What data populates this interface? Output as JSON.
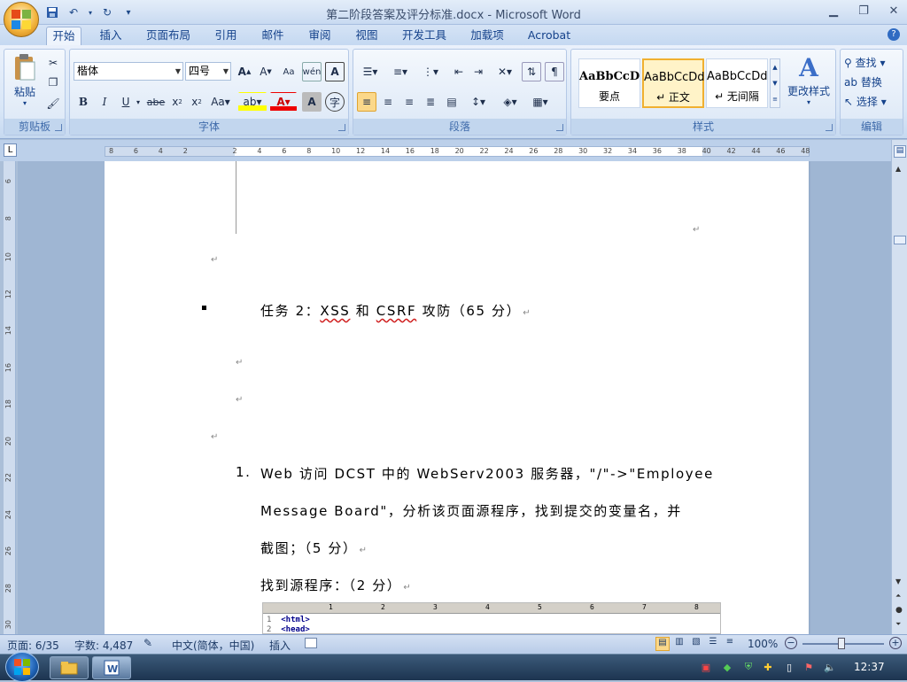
{
  "window": {
    "title": "第二阶段答案及评分标准.docx - Microsoft Word"
  },
  "quick_access": [
    "save-icon",
    "undo-icon",
    "redo-icon",
    "customize-icon"
  ],
  "tabs": [
    "开始",
    "插入",
    "页面布局",
    "引用",
    "邮件",
    "审阅",
    "视图",
    "开发工具",
    "加载项",
    "Acrobat"
  ],
  "ribbon": {
    "clipboard": {
      "label": "剪贴板",
      "paste": "粘贴"
    },
    "font": {
      "label": "字体",
      "font_name": "楷体",
      "font_size": "四号"
    },
    "paragraph": {
      "label": "段落"
    },
    "styles": {
      "label": "样式",
      "items": [
        {
          "sample": "AaBbCcD",
          "name": "要点"
        },
        {
          "sample": "AaBbCcDd",
          "name": "↵ 正文"
        },
        {
          "sample": "AaBbCcDd",
          "name": "↵ 无间隔"
        }
      ],
      "change_styles": "更改样式"
    },
    "editing": {
      "label": "编辑",
      "find": "查找",
      "replace": "替换",
      "select": "选择"
    }
  },
  "ruler": {
    "h_ticks": [
      "8",
      "6",
      "4",
      "2",
      "",
      "2",
      "4",
      "6",
      "8",
      "10",
      "12",
      "14",
      "16",
      "18",
      "20",
      "22",
      "24",
      "26",
      "28",
      "30",
      "32",
      "34",
      "36",
      "38",
      "40",
      "42",
      "44",
      "46",
      "48"
    ],
    "v_ticks": [
      "6",
      "8",
      "10",
      "12",
      "14",
      "16",
      "18",
      "20",
      "22",
      "24",
      "26",
      "28",
      "30"
    ]
  },
  "document": {
    "task_heading_num": "任务",
    "task_heading": "任务 2：XSS 和 CSRF 攻防（65 分）",
    "item_number": "1.",
    "item_line1": "Web 访问 DCST 中的 WebServ2003 服务器，\"/\"->\"Employee",
    "item_line2": "Message Board\"，分析该页面源程序，找到提交的变量名，并",
    "item_line3": "截图；（5 分）",
    "item_line4": "找到源程序：（2 分）",
    "code_ruler_marks": [
      "1",
      "2",
      "3",
      "4",
      "5",
      "6",
      "7",
      "8"
    ],
    "code_lines": [
      {
        "num": "1",
        "text": "<html>"
      },
      {
        "num": "2",
        "text": "<head>"
      }
    ],
    "para_mark": "↵"
  },
  "status": {
    "page": "页面: 6/35",
    "words": "字数: 4,487",
    "language": "中文(简体，中国)",
    "mode": "插入",
    "zoom": "100%"
  },
  "taskbar": {
    "clock": "12:37"
  }
}
